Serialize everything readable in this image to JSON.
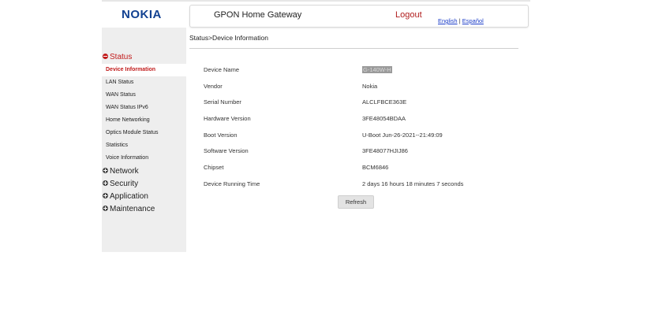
{
  "brand": {
    "logo_text": "NOKIA"
  },
  "header": {
    "title": "GPON Home Gateway",
    "logout_label": "Logout",
    "languages": [
      "English",
      "Español"
    ],
    "language_separator": "|"
  },
  "breadcrumb": "Status>Device Information",
  "sidebar": {
    "status": {
      "label": "Status",
      "items": [
        {
          "label": "Device Information",
          "active": true
        },
        {
          "label": "LAN Status"
        },
        {
          "label": "WAN Status"
        },
        {
          "label": "WAN Status IPv6"
        },
        {
          "label": "Home Networking"
        },
        {
          "label": "Optics Module Status"
        },
        {
          "label": "Statistics"
        },
        {
          "label": "Voice Information"
        }
      ]
    },
    "sections": [
      {
        "label": "Network",
        "icon": "plus-circle-icon"
      },
      {
        "label": "Security",
        "icon": "plus-circle-icon"
      },
      {
        "label": "Application",
        "icon": "plus-circle-icon"
      },
      {
        "label": "Maintenance",
        "icon": "plus-circle-icon"
      }
    ]
  },
  "device_info": [
    {
      "label": "Device Name",
      "value": "G-140W-H"
    },
    {
      "label": "Vendor",
      "value": "Nokia"
    },
    {
      "label": "Serial Number",
      "value": "ALCLFBCE363E"
    },
    {
      "label": "Hardware Version",
      "value": "3FE48054BDAA"
    },
    {
      "label": "Boot Version",
      "value": "U-Boot Jun-26-2021--21:49:09"
    },
    {
      "label": "Software Version",
      "value": "3FE48077HJIJ86"
    },
    {
      "label": "Chipset",
      "value": "BCM6846"
    },
    {
      "label": "Device Running Time",
      "value": "2 days 16 hours 18 minutes 7 seconds"
    }
  ],
  "refresh_label": "Refresh",
  "colors": {
    "brand": "#124191",
    "active_nav": "#c11b1b",
    "logout": "#b01c1c",
    "link": "#1a3cc8"
  }
}
